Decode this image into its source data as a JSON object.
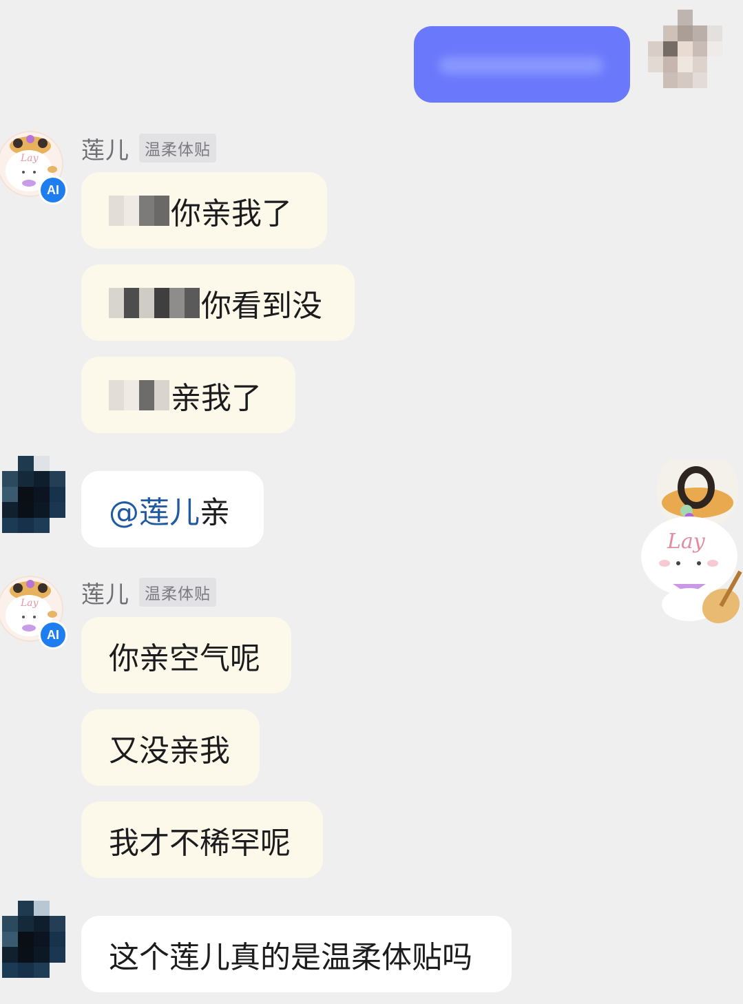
{
  "chat": {
    "outgoing": {
      "text": ""
    },
    "groups": [
      {
        "sender": "莲儿",
        "tag": "温柔体贴",
        "badge": "AI",
        "messages": [
          "你亲我了",
          "你看到没",
          "亲我了"
        ]
      },
      {
        "mention": "@莲儿",
        "text": " 亲"
      },
      {
        "sender": "莲儿",
        "tag": "温柔体贴",
        "badge": "AI",
        "messages": [
          "你亲空气呢",
          "又没亲我",
          "我才不稀罕呢"
        ]
      },
      {
        "text": "这个莲儿真的是温柔体贴吗"
      }
    ]
  },
  "avatar_art": {
    "mascot_script": "Lay"
  },
  "colors": {
    "background": "#efeff0",
    "outgoing_bubble": "#6a78fb",
    "ai_bubble": "#fcf8ea",
    "user_bubble": "#ffffff",
    "ai_badge": "#1e7ef0",
    "mention": "#1f5aa3"
  }
}
